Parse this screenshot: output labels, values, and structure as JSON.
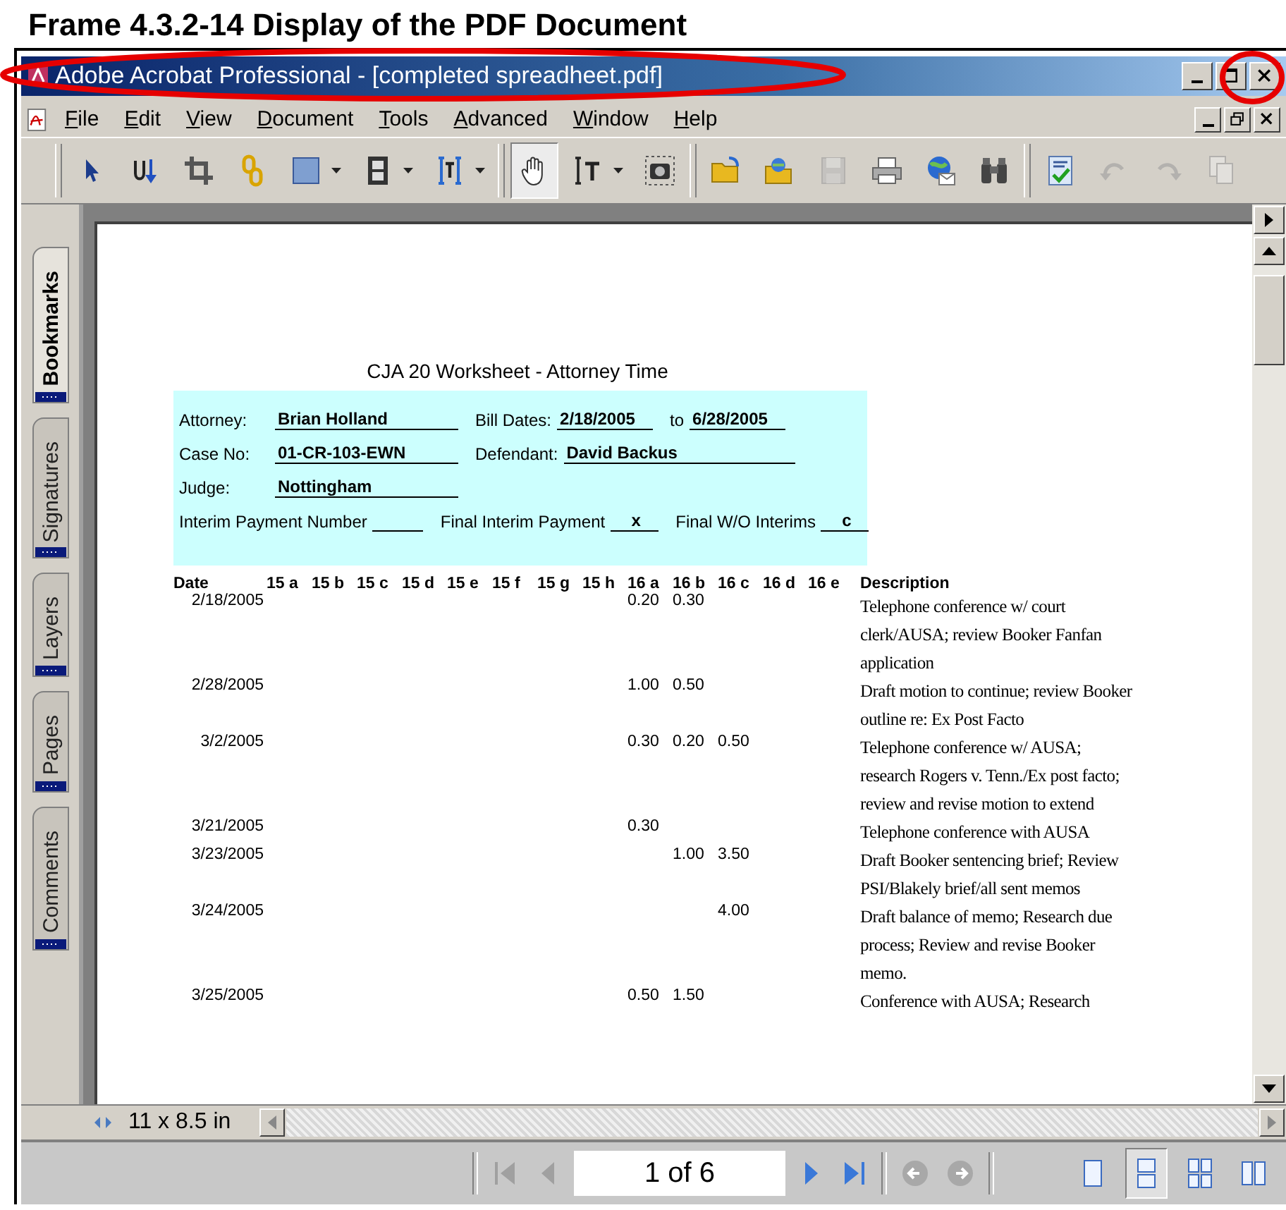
{
  "frame_caption": "Frame 4.3.2-14 Display of the PDF Document",
  "annotations": [
    {
      "kind": "ellipse"
    },
    {
      "kind": "ellipse"
    }
  ],
  "window": {
    "title": "Adobe Acrobat Professional - [completed spreadheet.pdf]"
  },
  "menu": [
    "File",
    "Edit",
    "View",
    "Document",
    "Tools",
    "Advanced",
    "Window",
    "Help"
  ],
  "toolbar_groups": [
    [
      {
        "kind": "select-arrow",
        "selected": false,
        "disabled": false,
        "dropdown": false
      },
      {
        "kind": "touchup",
        "selected": false,
        "disabled": false,
        "dropdown": false
      },
      {
        "kind": "crop",
        "selected": false,
        "disabled": false,
        "dropdown": false
      },
      {
        "kind": "link",
        "selected": false,
        "disabled": false,
        "dropdown": false
      },
      {
        "kind": "rectangle",
        "selected": false,
        "disabled": false,
        "dropdown": true
      },
      {
        "kind": "film",
        "selected": false,
        "disabled": false,
        "dropdown": true
      },
      {
        "kind": "text-field",
        "selected": false,
        "disabled": false,
        "dropdown": true
      }
    ],
    [
      {
        "kind": "hand",
        "selected": true,
        "disabled": false,
        "dropdown": false
      },
      {
        "kind": "text-select",
        "selected": false,
        "disabled": false,
        "dropdown": true
      },
      {
        "kind": "snapshot",
        "selected": false,
        "disabled": false,
        "dropdown": false
      }
    ],
    [
      {
        "kind": "open",
        "selected": false,
        "disabled": false,
        "dropdown": false
      },
      {
        "kind": "organizer",
        "selected": false,
        "disabled": false,
        "dropdown": false
      },
      {
        "kind": "save",
        "selected": false,
        "disabled": true,
        "dropdown": false
      },
      {
        "kind": "print",
        "selected": false,
        "disabled": false,
        "dropdown": false
      },
      {
        "kind": "email",
        "selected": false,
        "disabled": false,
        "dropdown": false
      },
      {
        "kind": "search",
        "selected": false,
        "disabled": false,
        "dropdown": false
      }
    ],
    [
      {
        "kind": "spellcheck",
        "selected": false,
        "disabled": false,
        "dropdown": false
      },
      {
        "kind": "undo",
        "selected": false,
        "disabled": true,
        "dropdown": false
      },
      {
        "kind": "redo",
        "selected": false,
        "disabled": true,
        "dropdown": false
      },
      {
        "kind": "copy",
        "selected": false,
        "disabled": true,
        "dropdown": false
      }
    ]
  ],
  "side_tabs": [
    {
      "label": "Bookmarks",
      "selected": true
    },
    {
      "label": "Signatures",
      "selected": false
    },
    {
      "label": "Layers",
      "selected": false
    },
    {
      "label": "Pages",
      "selected": false
    },
    {
      "label": "Comments",
      "selected": false
    }
  ],
  "worksheet": {
    "title": "CJA 20 Worksheet - Attorney Time",
    "form_lines": [
      [
        {
          "label": "Attorney:",
          "value": "Brian Holland"
        },
        {
          "label": "Bill Dates:",
          "value": "2/18/2005"
        },
        {
          "label": "to",
          "value": "6/28/2005"
        }
      ],
      [
        {
          "label": "Case No:",
          "value": "01-CR-103-EWN"
        },
        {
          "label": "Defendant:",
          "value": "David Backus"
        }
      ],
      [
        {
          "label": "Judge:",
          "value": "Nottingham"
        }
      ],
      [
        {
          "label": "Interim Payment Number"
        },
        {
          "label": "Final Interim Payment",
          "value": "x"
        },
        {
          "label": "Final W/O Interims",
          "value": "c"
        }
      ]
    ],
    "columns": [
      "Date",
      "15 a",
      "15 b",
      "15 c",
      "15 d",
      "15 e",
      "15 f",
      "15 g",
      "15 h",
      "16 a",
      "16 b",
      "16 c",
      "16 d",
      "16 e",
      "Description"
    ],
    "rows": [
      {
        "date": "2/18/2005",
        "hours": {
          "16a": "0.20",
          "16b": "0.30"
        },
        "description": "Telephone conference w/ court clerk/AUSA; review Booker Fanfan application"
      },
      {
        "date": "2/28/2005",
        "hours": {
          "16a": "1.00",
          "16b": "0.50"
        },
        "description": "Draft motion to continue; review Booker outline re: Ex Post Facto"
      },
      {
        "date": "3/2/2005",
        "hours": {
          "16a": "0.30",
          "16b": "0.20",
          "16c": "0.50"
        },
        "description": "Telephone conference w/ AUSA; research Rogers v. Tenn./Ex post facto; review and revise motion to extend"
      },
      {
        "date": "3/21/2005",
        "hours": {
          "16a": "0.30"
        },
        "description": "Telephone conference with AUSA"
      },
      {
        "date": "3/23/2005",
        "hours": {
          "16b": "1.00",
          "16c": "3.50"
        },
        "description": "Draft Booker sentencing brief; Review PSI/Blakely brief/all sent memos"
      },
      {
        "date": "3/24/2005",
        "hours": {
          "16c": "4.00"
        },
        "description": "Draft balance of memo; Research due process; Review and revise Booker memo."
      },
      {
        "date": "3/25/2005",
        "hours": {
          "16a": "0.50",
          "16b": "1.50"
        },
        "description": "Conference with AUSA; Research"
      }
    ]
  },
  "page_size": "11 x 8.5 in",
  "navigation": {
    "buttons": [
      {
        "kind": "first",
        "disabled": true
      },
      {
        "kind": "previous",
        "disabled": true
      }
    ],
    "page": "1 of 6",
    "buttons_after": [
      {
        "kind": "next",
        "disabled": false
      },
      {
        "kind": "last",
        "disabled": false
      }
    ],
    "history": [
      {
        "kind": "back",
        "disabled": true
      },
      {
        "kind": "forward",
        "disabled": true
      }
    ]
  },
  "page_layouts": [
    {
      "kind": "single",
      "selected": false
    },
    {
      "kind": "continuous",
      "selected": true
    },
    {
      "kind": "continuous-facing",
      "selected": false
    },
    {
      "kind": "facing",
      "selected": false
    }
  ]
}
